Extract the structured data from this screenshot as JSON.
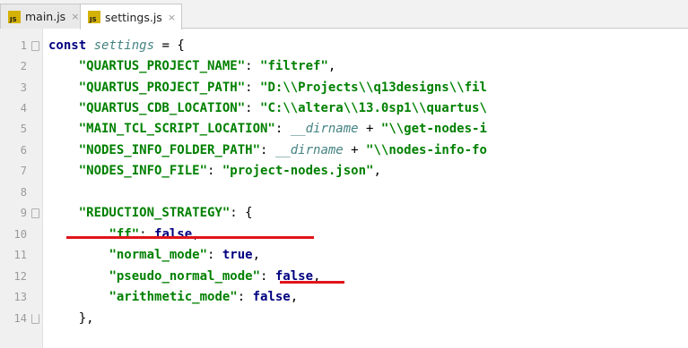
{
  "tabs": [
    {
      "label": "main.js",
      "close": "×",
      "icon": "JS"
    },
    {
      "label": "settings.js",
      "close": "×",
      "icon": "JS"
    }
  ],
  "lines": [
    {
      "no": "1",
      "t": [
        [
          "const",
          "kw"
        ],
        [
          " ",
          ""
        ],
        [
          "settings",
          "nm"
        ],
        [
          " = {",
          ""
        ]
      ]
    },
    {
      "no": "2",
      "t": [
        [
          "    ",
          ""
        ],
        [
          "\"QUARTUS_PROJECT_NAME\"",
          "str"
        ],
        [
          ": ",
          ""
        ],
        [
          "\"filtref\"",
          "str"
        ],
        [
          ",",
          ""
        ]
      ]
    },
    {
      "no": "3",
      "t": [
        [
          "    ",
          ""
        ],
        [
          "\"QUARTUS_PROJECT_PATH\"",
          "str"
        ],
        [
          ": ",
          ""
        ],
        [
          "\"D:\\\\Projects\\\\q13designs\\\\fil",
          "str"
        ]
      ]
    },
    {
      "no": "4",
      "t": [
        [
          "    ",
          ""
        ],
        [
          "\"QUARTUS_CDB_LOCATION\"",
          "str"
        ],
        [
          ": ",
          ""
        ],
        [
          "\"C:\\\\altera\\\\13.0sp1\\\\quartus\\",
          "str"
        ]
      ]
    },
    {
      "no": "5",
      "t": [
        [
          "    ",
          ""
        ],
        [
          "\"MAIN_TCL_SCRIPT_LOCATION\"",
          "str"
        ],
        [
          ": ",
          ""
        ],
        [
          "__dirname",
          "nm"
        ],
        [
          " + ",
          ""
        ],
        [
          "\"\\\\get-nodes-i",
          "str"
        ]
      ]
    },
    {
      "no": "6",
      "t": [
        [
          "    ",
          ""
        ],
        [
          "\"NODES_INFO_FOLDER_PATH\"",
          "str"
        ],
        [
          ": ",
          ""
        ],
        [
          "__dirname",
          "nm"
        ],
        [
          " + ",
          ""
        ],
        [
          "\"\\\\nodes-info-fo",
          "str"
        ]
      ]
    },
    {
      "no": "7",
      "t": [
        [
          "    ",
          ""
        ],
        [
          "\"NODES_INFO_FILE\"",
          "str"
        ],
        [
          ": ",
          ""
        ],
        [
          "\"project-nodes.json\"",
          "str"
        ],
        [
          ",",
          ""
        ]
      ]
    },
    {
      "no": "8",
      "t": []
    },
    {
      "no": "9",
      "t": [
        [
          "    ",
          ""
        ],
        [
          "\"REDUCTION_STRATEGY\"",
          "str"
        ],
        [
          ": {",
          ""
        ]
      ]
    },
    {
      "no": "10",
      "t": [
        [
          "        ",
          ""
        ],
        [
          "\"ff\"",
          "str"
        ],
        [
          ": ",
          ""
        ],
        [
          "false",
          "bool"
        ],
        [
          ",",
          ""
        ]
      ]
    },
    {
      "no": "11",
      "t": [
        [
          "        ",
          ""
        ],
        [
          "\"normal_mode\"",
          "str"
        ],
        [
          ": ",
          ""
        ],
        [
          "true",
          "bool"
        ],
        [
          ",",
          ""
        ]
      ]
    },
    {
      "no": "12",
      "t": [
        [
          "        ",
          ""
        ],
        [
          "\"pseudo_normal_mode\"",
          "str"
        ],
        [
          ": ",
          ""
        ],
        [
          "false",
          "bool"
        ],
        [
          ",",
          ""
        ]
      ]
    },
    {
      "no": "13",
      "t": [
        [
          "        ",
          ""
        ],
        [
          "\"arithmetic_mode\"",
          "str"
        ],
        [
          ": ",
          ""
        ],
        [
          "false",
          "bool"
        ],
        [
          ",",
          ""
        ]
      ]
    },
    {
      "no": "14",
      "t": [
        [
          "    },",
          ""
        ]
      ]
    }
  ],
  "colors": {
    "keyword": "#000080",
    "string": "#008000",
    "identifier": "#458383",
    "annotation": "#e0141a"
  }
}
